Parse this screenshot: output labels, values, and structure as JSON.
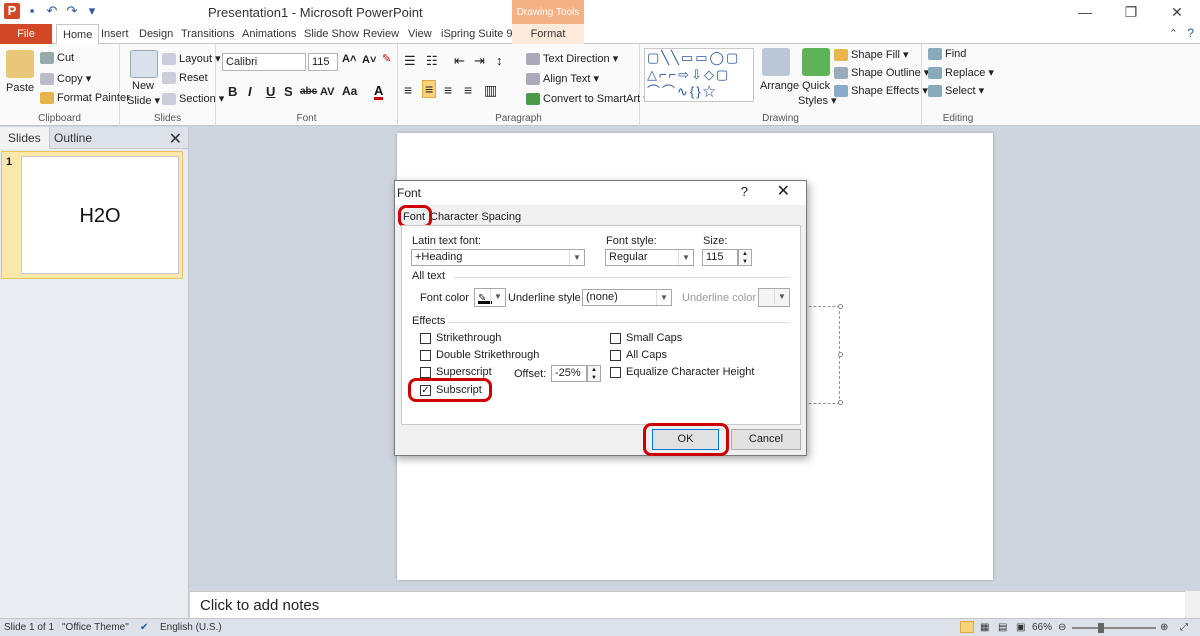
{
  "window": {
    "title": "Presentation1 - Microsoft PowerPoint",
    "context_group": "Drawing Tools"
  },
  "tabs": [
    "File",
    "Home",
    "Insert",
    "Design",
    "Transitions",
    "Animations",
    "Slide Show",
    "Review",
    "View",
    "iSpring Suite 9",
    "Format"
  ],
  "ribbon": {
    "clipboard": {
      "paste": "Paste",
      "cut": "Cut",
      "copy": "Copy ▾",
      "format_painter": "Format Painter",
      "label": "Clipboard"
    },
    "slides": {
      "new_slide": "New",
      "new_slide2": "Slide ▾",
      "layout": "Layout ▾",
      "reset": "Reset",
      "section": "Section ▾",
      "label": "Slides"
    },
    "font": {
      "font_name": "Calibri (Headings",
      "font_size": "115",
      "label": "Font"
    },
    "paragraph": {
      "text_direction": "Text Direction ▾",
      "align_text": "Align Text ▾",
      "convert_smartart": "Convert to SmartArt ▾",
      "label": "Paragraph"
    },
    "drawing": {
      "arrange": "Arrange",
      "quick_styles": "Quick",
      "quick_styles2": "Styles ▾",
      "shape_fill": "Shape Fill ▾",
      "shape_outline": "Shape Outline ▾",
      "shape_effects": "Shape Effects ▾",
      "label": "Drawing"
    },
    "editing": {
      "find": "Find",
      "replace": "Replace ▾",
      "select": "Select ▾",
      "label": "Editing"
    }
  },
  "panel": {
    "tab_slides": "Slides",
    "tab_outline": "Outline",
    "slide_number": "1",
    "thumb_text": "H2O"
  },
  "notes": {
    "placeholder": "Click to add notes"
  },
  "status": {
    "slide": "Slide 1 of 1",
    "theme": "\"Office Theme\"",
    "language": "English (U.S.)",
    "zoom": "66%"
  },
  "dialog": {
    "title": "Font",
    "help": "?",
    "close": "✕",
    "tab_font": "Font",
    "tab_spacing": "Character Spacing",
    "latin_label": "Latin text font:",
    "latin_value": "+Heading",
    "style_label": "Font style:",
    "style_value": "Regular",
    "size_label": "Size:",
    "size_value": "115",
    "all_text": "All text",
    "font_color": "Font color",
    "underline_style": "Underline style",
    "underline_value": "(none)",
    "underline_color": "Underline color",
    "effects": "Effects",
    "strikethrough": "Strikethrough",
    "double_strike": "Double Strikethrough",
    "superscript": "Superscript",
    "subscript": "Subscript",
    "offset_label": "Offset:",
    "offset_value": "-25%",
    "small_caps": "Small Caps",
    "all_caps": "All Caps",
    "equalize": "Equalize Character Height",
    "ok": "OK",
    "cancel": "Cancel",
    "subscript_checked": true
  },
  "colors": {
    "accent": "#d24726",
    "highlight_ring": "#cc0000",
    "context_tab": "#f4b183"
  }
}
